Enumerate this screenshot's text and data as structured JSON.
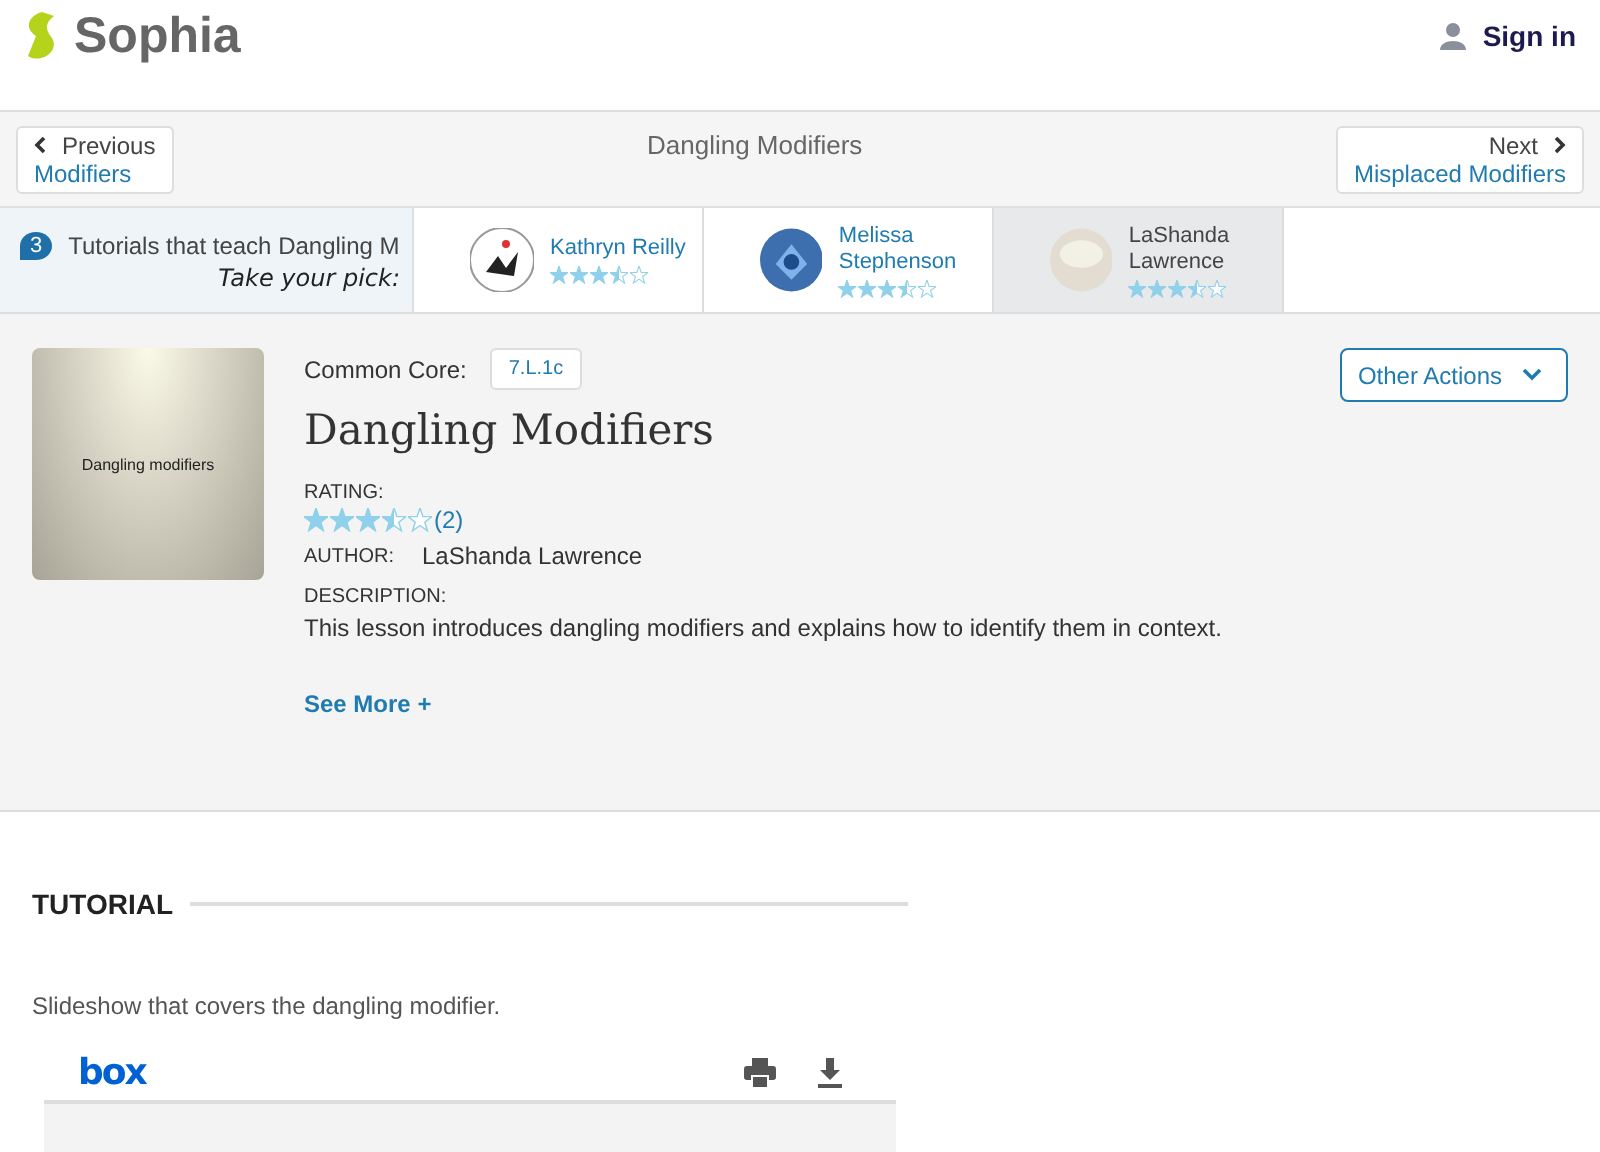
{
  "header": {
    "logo": "Sophia",
    "sign_in": "Sign in"
  },
  "nav": {
    "previous": {
      "label": "Previous",
      "title": "Modifiers"
    },
    "current": "Dangling Modifiers",
    "next": {
      "label": "Next",
      "title": "Misplaced Modifiers"
    }
  },
  "tutorials": {
    "count": "3",
    "text": "Tutorials that teach Dangling M",
    "pick": "Take your pick:",
    "items": [
      {
        "author": "Kathryn Reilly",
        "stars": 3.5,
        "selected": false
      },
      {
        "author": "Melissa Stephenson",
        "stars": 3.5,
        "selected": false
      },
      {
        "author": "LaShanda Lawrence",
        "stars": 3.5,
        "selected": true
      }
    ]
  },
  "lesson": {
    "thumbnail_text": "Dangling modifiers",
    "common_core_label": "Common Core:",
    "standard": "7.L.1c",
    "title": "Dangling Modifiers",
    "other_actions": "Other Actions",
    "rating_label": "RATING:",
    "stars": 3.5,
    "rating_count": "(2)",
    "author_label": "AUTHOR:",
    "author": "LaShanda Lawrence",
    "description_label": "DESCRIPTION:",
    "description": "This lesson introduces dangling modifiers and explains how to identify them in context.",
    "see_more": "See More +"
  },
  "tutorial": {
    "heading": "TUTORIAL",
    "summary": "Slideshow that covers the dangling modifier.",
    "viewer_logo": "box"
  }
}
